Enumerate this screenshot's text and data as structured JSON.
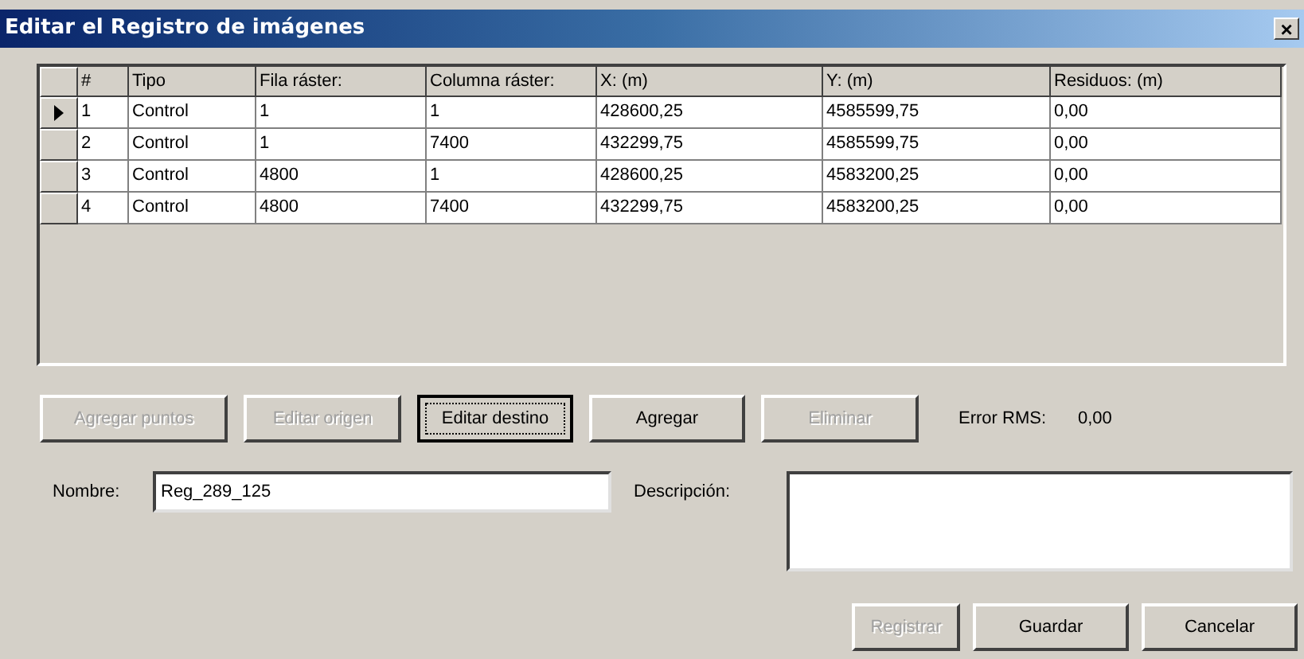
{
  "window": {
    "title": "Editar el Registro de imágenes",
    "close": "×"
  },
  "table": {
    "columns": [
      "#",
      "Tipo",
      "Fila ráster:",
      "Columna ráster:",
      "X: (m)",
      "Y: (m)",
      "Residuos: (m)"
    ],
    "rows": [
      {
        "selected": true,
        "cells": [
          "1",
          "Control",
          "1",
          "1",
          "428600,25",
          "4585599,75",
          "0,00"
        ]
      },
      {
        "selected": false,
        "cells": [
          "2",
          "Control",
          "1",
          "7400",
          "432299,75",
          "4585599,75",
          "0,00"
        ]
      },
      {
        "selected": false,
        "cells": [
          "3",
          "Control",
          "4800",
          "1",
          "428600,25",
          "4583200,25",
          "0,00"
        ]
      },
      {
        "selected": false,
        "cells": [
          "4",
          "Control",
          "4800",
          "7400",
          "432299,75",
          "4583200,25",
          "0,00"
        ]
      }
    ]
  },
  "actions": [
    {
      "label": "Agregar puntos",
      "disabled": true,
      "focused": false
    },
    {
      "label": "Editar origen",
      "disabled": true,
      "focused": false
    },
    {
      "label": "Editar destino",
      "disabled": false,
      "focused": true
    },
    {
      "label": "Agregar",
      "disabled": false,
      "focused": false
    },
    {
      "label": "Eliminar",
      "disabled": true,
      "focused": false
    }
  ],
  "rms": {
    "label": "Error RMS:",
    "value": "0,00"
  },
  "name_field": {
    "label": "Nombre:",
    "value": "Reg_289_125"
  },
  "description_field": {
    "label": "Descripción:"
  },
  "footer_buttons": [
    {
      "label": "Registrar",
      "disabled": true
    },
    {
      "label": "Guardar",
      "disabled": false
    },
    {
      "label": "Cancelar",
      "disabled": false
    }
  ]
}
